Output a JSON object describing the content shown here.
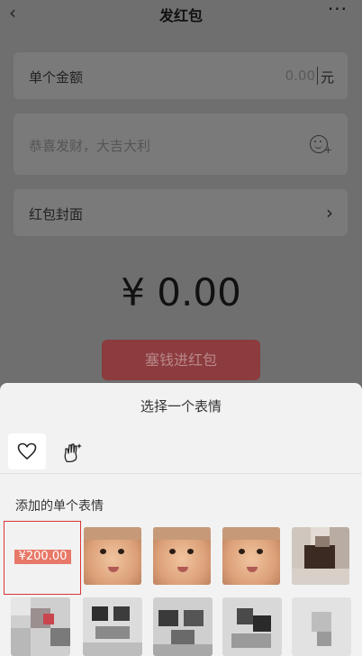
{
  "header": {
    "back_icon": "chevron-left-icon",
    "title": "发红包",
    "more": "···"
  },
  "form": {
    "amount_label": "单个金额",
    "amount_value": "0.00",
    "amount_unit": "元",
    "greeting_placeholder": "恭喜发财，大吉大利",
    "cover_label": "红包封面",
    "big_amount": "¥ 0.00",
    "send_button": "塞钱进红包"
  },
  "sticker_panel": {
    "title": "选择一个表情",
    "tabs": [
      {
        "icon": "heart-icon",
        "selected": true
      },
      {
        "icon": "hand-sparkle-icon",
        "selected": false
      }
    ],
    "section_title": "添加的单个表情",
    "selected_sticker_text": "¥200.00"
  },
  "colors": {
    "overlay": "#6f6f6f",
    "send_button": "#8c3b3f",
    "selection_border": "#d93636",
    "price_tag": "#e87868",
    "sheet_background": "#f2f2f2"
  }
}
